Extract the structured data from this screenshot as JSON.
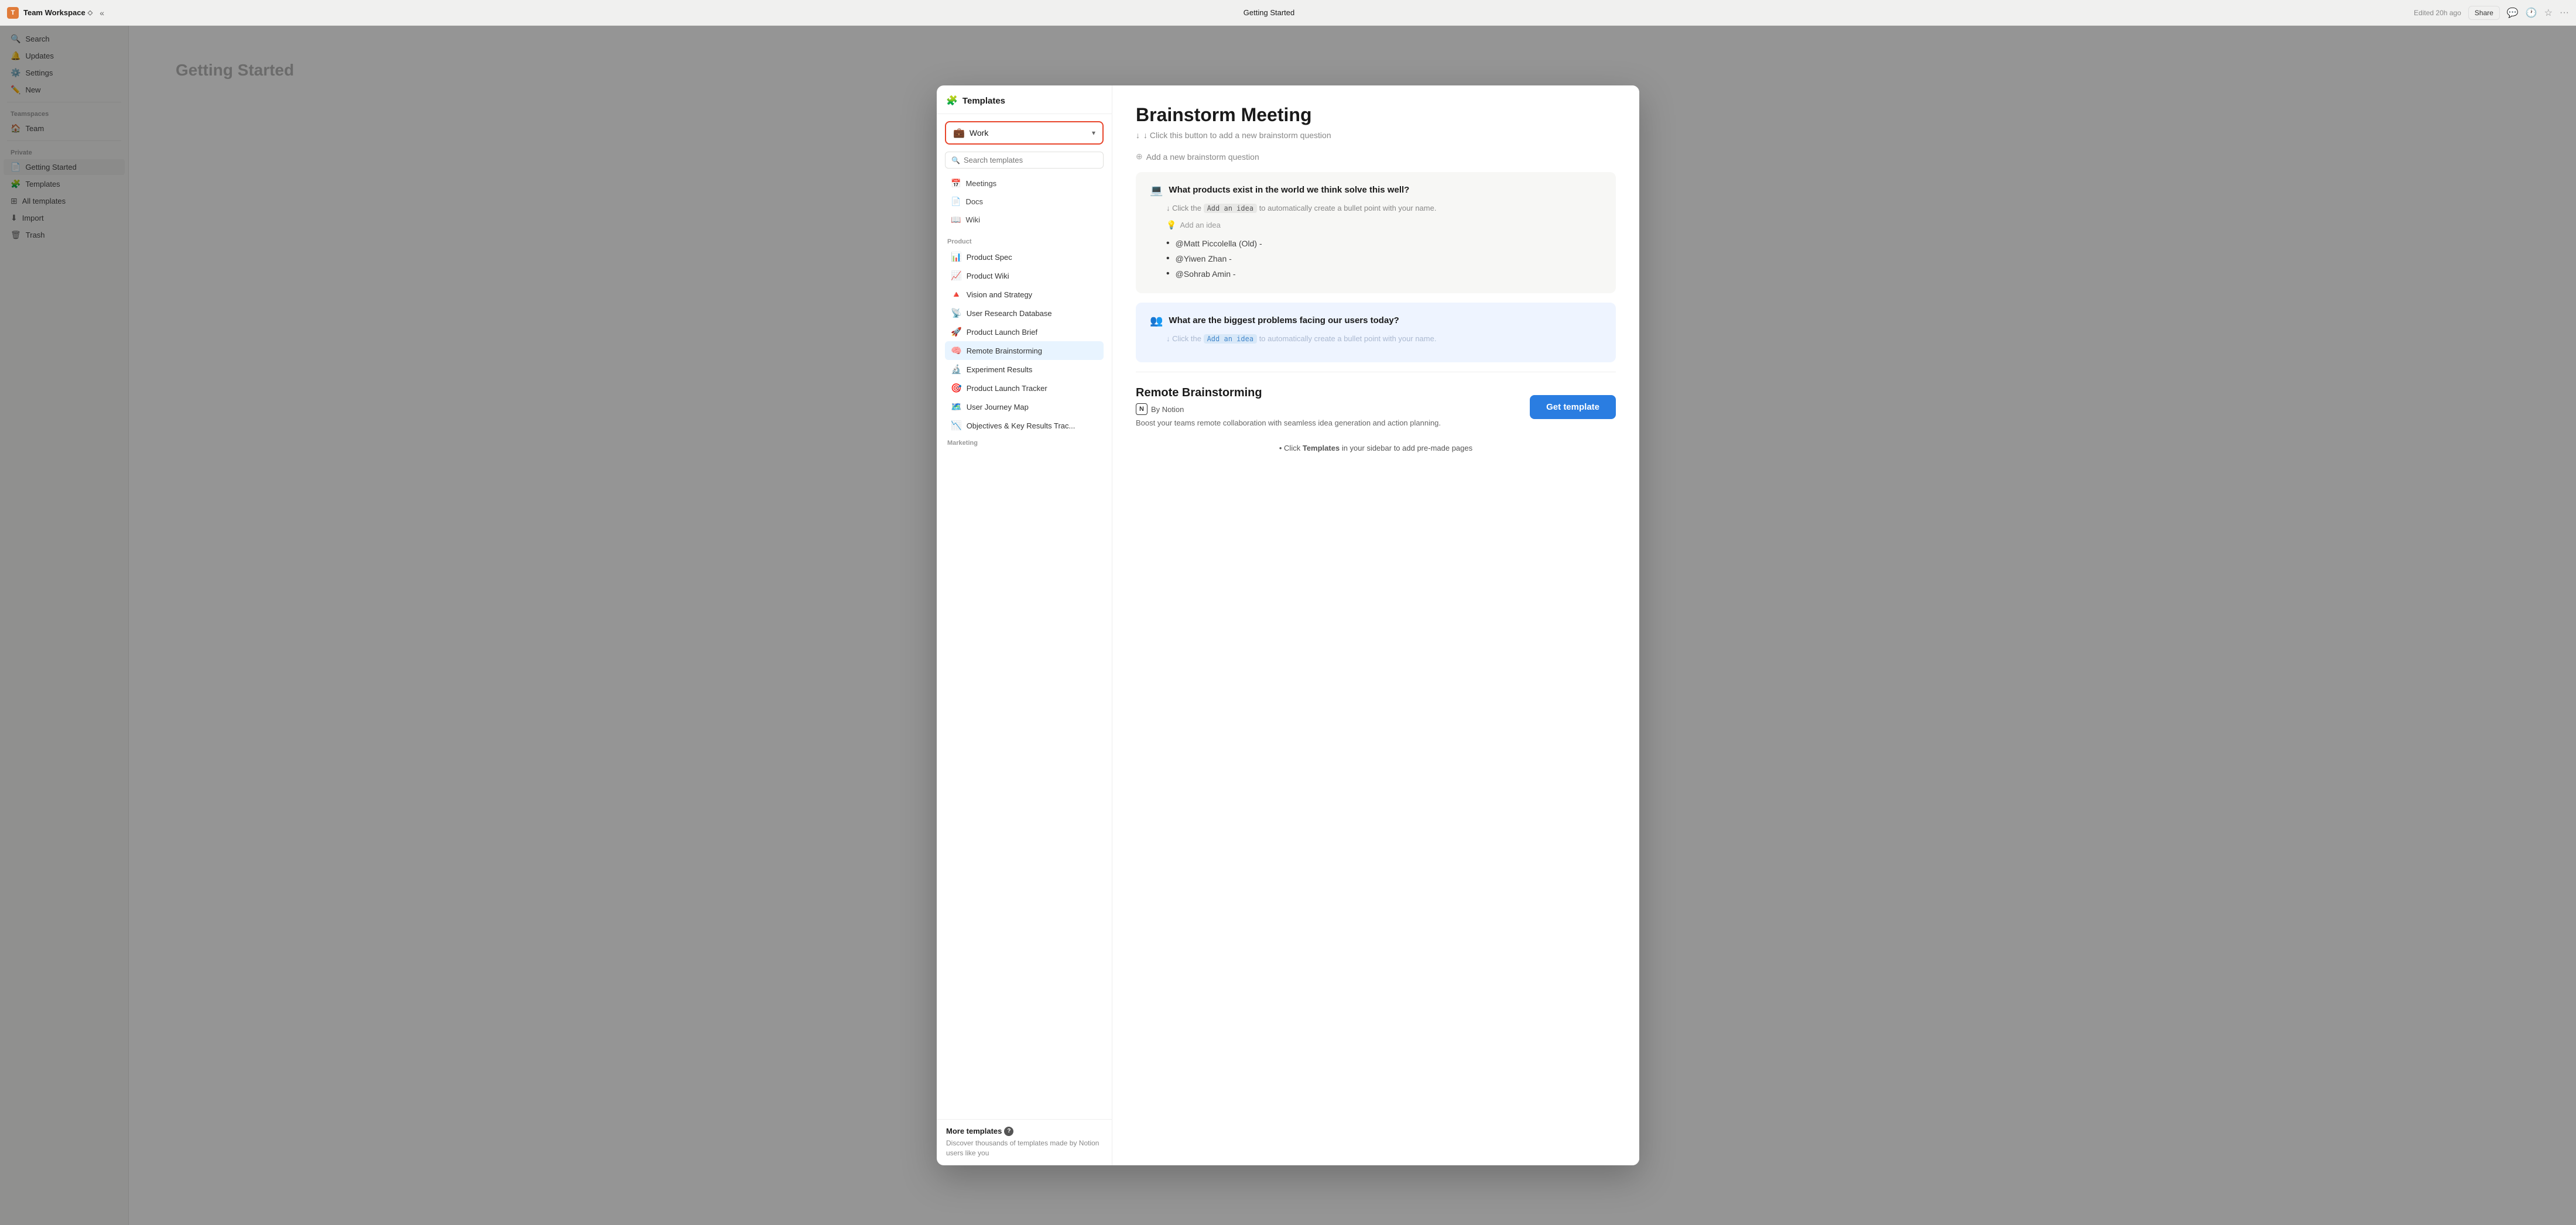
{
  "topBar": {
    "workspaceName": "Team Workspace",
    "chevron": "◇",
    "collapseLabel": "«",
    "pageTitle": "Getting Started",
    "editedLabel": "Edited 20h ago",
    "shareLabel": "Share"
  },
  "sidebar": {
    "searchLabel": "Search",
    "updatesLabel": "Updates",
    "settingsLabel": "Settings",
    "newLabel": "New",
    "teamspaceSectionLabel": "Teamspaces",
    "teamItem": "Team",
    "privateSectionLabel": "Private",
    "getStartedItem": "Getting Started",
    "templatesItem": "Templates",
    "allTemplates": "All templates",
    "importItem": "Import",
    "trashItem": "Trash"
  },
  "modal": {
    "headerTitle": "Templates",
    "headerIcon": "🧩",
    "categoryLabel": "Work",
    "categoryIcon": "💼",
    "searchPlaceholder": "Search templates",
    "navItems": [
      {
        "icon": "📅",
        "label": "Meetings"
      },
      {
        "icon": "📄",
        "label": "Docs"
      },
      {
        "icon": "📖",
        "label": "Wiki"
      }
    ],
    "productSection": "Product",
    "templateList": [
      {
        "icon": "📊",
        "label": "Product Spec"
      },
      {
        "icon": "📈",
        "label": "Product Wiki"
      },
      {
        "icon": "🔺",
        "label": "Vision and Strategy"
      },
      {
        "icon": "📡",
        "label": "User Research Database"
      },
      {
        "icon": "🚀",
        "label": "Product Launch Brief"
      },
      {
        "icon": "🧠",
        "label": "Remote Brainstorming",
        "selected": true
      },
      {
        "icon": "🔬",
        "label": "Experiment Results"
      },
      {
        "icon": "🎯",
        "label": "Product Launch Tracker"
      },
      {
        "icon": "🗺️",
        "label": "User Journey Map"
      },
      {
        "icon": "📉",
        "label": "Objectives & Key Results Trac..."
      }
    ],
    "marketingSection": "Marketing",
    "moreTemplatesTitle": "More templates",
    "moreTemplatesCircle": "?",
    "moreTemplatesDesc": "Discover thousands of templates made by Notion users like you"
  },
  "rightPanel": {
    "title": "Brainstorm Meeting",
    "addQuestionHint": "↓ Click this button to add a new brainstorm question",
    "addQuestionLabel": "Add a new brainstorm question",
    "questionBlocks": [
      {
        "color": "gray",
        "icon": "💻",
        "question": "What products exist in the world we think solve this well?",
        "hint": "↓ Click the",
        "hintCode": "Add an idea",
        "hintSuffix": "to automatically create a bullet point with your name.",
        "addIdeaLabel": "Add an idea",
        "bullets": [
          "@Matt Piccolella (Old) -",
          "@Yiwen Zhan -",
          "@Sohrab Amin -"
        ]
      },
      {
        "color": "blue",
        "icon": "👥",
        "question": "What are the biggest problems facing our users today?",
        "hint": "↓ Click the",
        "hintCode": "Add an idea",
        "hintSuffix": "to automatically create a bullet point with your name.",
        "bullets": []
      }
    ],
    "templateName": "Remote Brainstorming",
    "byLabel": "By Notion",
    "notionN": "N",
    "templateDesc": "Boost your teams remote collaboration with seamless idea generation and action planning.",
    "getTemplateLabel": "Get template",
    "bottomHint": "Click",
    "bottomHintBold": "Templates",
    "bottomHintSuffix": "in your sidebar to add pre-made pages"
  },
  "colors": {
    "accent": "#2a7de1",
    "selectedBg": "#e8f4ff",
    "categoryBorder": "#e8442a",
    "getTemplateBg": "#2a7de1"
  }
}
